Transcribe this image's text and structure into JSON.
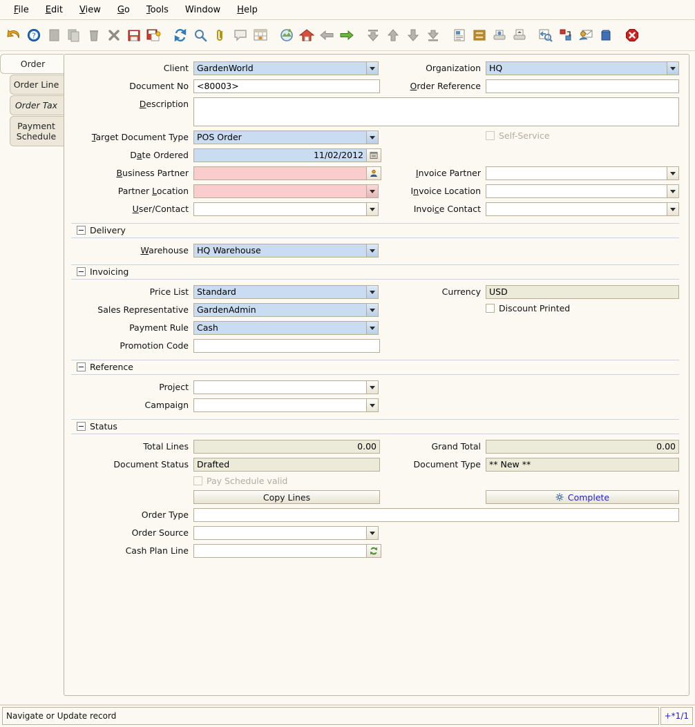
{
  "menu": {
    "items": [
      {
        "label": "File",
        "mnemonic": "F"
      },
      {
        "label": "Edit",
        "mnemonic": "E"
      },
      {
        "label": "View",
        "mnemonic": "V"
      },
      {
        "label": "Go",
        "mnemonic": "G"
      },
      {
        "label": "Tools",
        "mnemonic": "T"
      },
      {
        "label": "Window",
        "mnemonic": ""
      },
      {
        "label": "Help",
        "mnemonic": "H"
      }
    ]
  },
  "toolbar": {
    "icons": [
      "undo-icon",
      "help-icon",
      "new-record-icon",
      "copy-record-icon",
      "delete-record-icon",
      "delete-selection-icon",
      "save-icon",
      "save-create-new-icon",
      "refresh-icon",
      "find-icon",
      "attachment-icon",
      "chat-icon",
      "grid-toggle-icon",
      "history-icon",
      "home-icon",
      "previous-record-icon",
      "next-record-icon",
      "first-record-icon",
      "previous-page-icon",
      "next-page-icon",
      "last-record-icon",
      "report-icon",
      "archive-icon",
      "print-preview-icon",
      "print-icon",
      "zoom-across-icon",
      "active-workflow-icon",
      "request-icon",
      "product-info-icon",
      "exit-icon"
    ]
  },
  "tabs": [
    {
      "label": "Order",
      "active": true,
      "italic": false,
      "indent": false
    },
    {
      "label": "Order Line",
      "active": false,
      "italic": false,
      "indent": true
    },
    {
      "label": "Order Tax",
      "active": false,
      "italic": true,
      "indent": true
    },
    {
      "label": "Payment Schedule",
      "active": false,
      "italic": false,
      "indent": false
    }
  ],
  "form": {
    "client": {
      "label": "Client",
      "mnemonic": "",
      "value": "GardenWorld"
    },
    "organization": {
      "label": "Organization",
      "mnemonic": "",
      "value": "HQ"
    },
    "document_no": {
      "label": "Document No",
      "mnemonic": "",
      "value": "<80003>"
    },
    "order_reference": {
      "label": "Order Reference",
      "mnemonic": "O",
      "value": ""
    },
    "description": {
      "label": "Description",
      "mnemonic": "D",
      "value": ""
    },
    "target_document_type": {
      "label": "Target Document Type",
      "mnemonic": "T",
      "value": "POS Order"
    },
    "self_service": {
      "label": "Self-Service",
      "checked": false,
      "disabled": true
    },
    "date_ordered": {
      "label": "Date Ordered",
      "mnemonic": "a",
      "value": "11/02/2012"
    },
    "business_partner": {
      "label": "Business Partner",
      "mnemonic": "B",
      "value": "",
      "mandatory": true
    },
    "invoice_partner": {
      "label": "Invoice Partner",
      "mnemonic": "I",
      "value": ""
    },
    "partner_location": {
      "label": "Partner Location",
      "mnemonic": "L",
      "value": "",
      "mandatory": true
    },
    "invoice_location": {
      "label": "Invoice Location",
      "mnemonic": "n",
      "value": ""
    },
    "user_contact": {
      "label": "User/Contact",
      "mnemonic": "U",
      "value": ""
    },
    "invoice_contact": {
      "label": "Invoice Contact",
      "mnemonic": "c",
      "value": ""
    }
  },
  "delivery": {
    "title": "Delivery",
    "warehouse": {
      "label": "Warehouse",
      "mnemonic": "W",
      "value": "HQ Warehouse"
    }
  },
  "invoicing": {
    "title": "Invoicing",
    "price_list": {
      "label": "Price List",
      "value": "Standard"
    },
    "currency": {
      "label": "Currency",
      "value": "USD"
    },
    "sales_representative": {
      "label": "Sales Representative",
      "value": "GardenAdmin"
    },
    "discount_printed": {
      "label": "Discount Printed",
      "checked": false
    },
    "payment_rule": {
      "label": "Payment Rule",
      "value": "Cash"
    },
    "promotion_code": {
      "label": "Promotion Code",
      "value": ""
    }
  },
  "reference": {
    "title": "Reference",
    "project": {
      "label": "Project",
      "value": ""
    },
    "campaign": {
      "label": "Campaign",
      "value": ""
    }
  },
  "status": {
    "title": "Status",
    "total_lines": {
      "label": "Total Lines",
      "value": "0.00"
    },
    "grand_total": {
      "label": "Grand Total",
      "value": "0.00"
    },
    "document_status": {
      "label": "Document Status",
      "value": "Drafted"
    },
    "document_type": {
      "label": "Document Type",
      "value": "** New **"
    },
    "pay_schedule_valid": {
      "label": "Pay Schedule valid",
      "checked": false,
      "disabled": true
    },
    "copy_lines_button": {
      "label": "Copy Lines"
    },
    "complete_button": {
      "label": "Complete",
      "icon": "gear-icon"
    },
    "order_type": {
      "label": "Order Type",
      "value": ""
    },
    "order_source": {
      "label": "Order Source",
      "value": ""
    },
    "cash_plan_line": {
      "label": "Cash Plan Line",
      "value": ""
    }
  },
  "statusbar": {
    "message": "Navigate or Update record",
    "record_count": "+*1/1"
  },
  "colors": {
    "window_bg": "#fbf9f2",
    "selected_field": "#c9dcf2",
    "readonly_field": "#ecebd9",
    "mandatory_field": "#f9ccce",
    "link_text": "#2222cc",
    "section_rule": "#c8d4e6"
  }
}
